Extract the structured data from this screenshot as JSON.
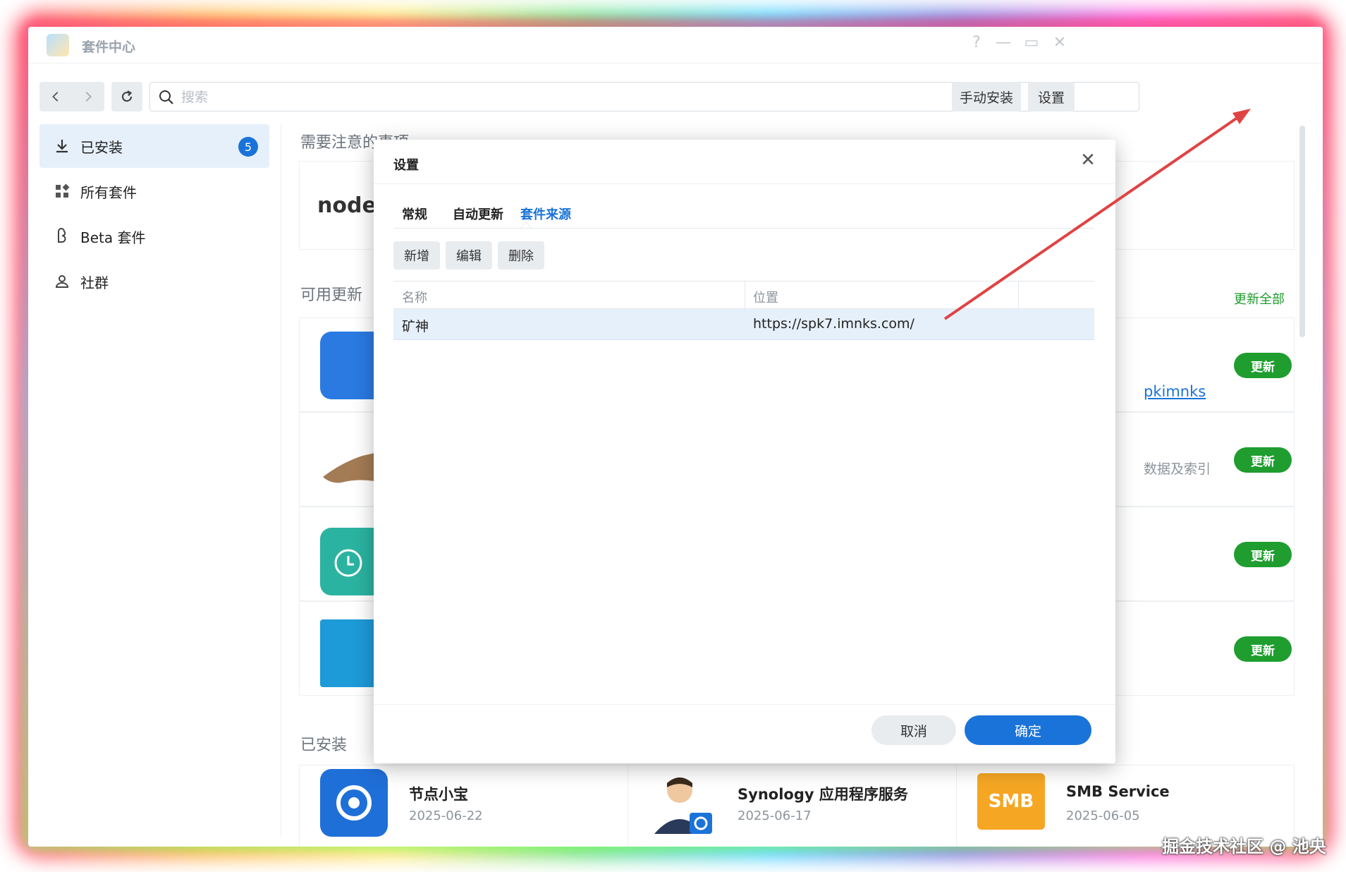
{
  "window": {
    "title": "套件中心",
    "controls": {
      "help": "?",
      "minimize": "—",
      "maximize": "▭",
      "close": "✕"
    }
  },
  "toolbar": {
    "search_placeholder": "搜索",
    "manual_install": "手动安装",
    "settings": "设置"
  },
  "sidebar": {
    "items": [
      {
        "label": "已安装",
        "icon": "download-icon",
        "badge": "5",
        "active": true
      },
      {
        "label": "所有套件",
        "icon": "grid-icon"
      },
      {
        "label": "Beta 套件",
        "icon": "beta-icon"
      },
      {
        "label": "社群",
        "icon": "community-icon"
      }
    ]
  },
  "main": {
    "attention_title": "需要注意的事项",
    "attention_logo": "node",
    "updates_title": "可用更新",
    "update_all": "更新全部",
    "update_label": "更新",
    "peek_link": "pkimnks",
    "peek_text": "数据及索引",
    "installed_title": "已安装",
    "installed": [
      {
        "name": "节点小宝",
        "date": "2025-06-22",
        "icon": "node-helper-icon"
      },
      {
        "name": "Synology 应用程序服务",
        "date": "2025-06-17",
        "icon": "app-service-icon"
      },
      {
        "name": "SMB Service",
        "date": "2025-06-05",
        "icon": "smb-icon",
        "icon_text": "SMB"
      }
    ]
  },
  "dialog": {
    "title": "设置",
    "tabs": [
      {
        "label": "常规"
      },
      {
        "label": "自动更新"
      },
      {
        "label": "套件来源",
        "active": true
      }
    ],
    "buttons": {
      "add": "新增",
      "edit": "编辑",
      "delete": "删除"
    },
    "columns": {
      "name": "名称",
      "location": "位置"
    },
    "rows": [
      {
        "name": "矿神",
        "location": "https://spk7.imnks.com/"
      }
    ],
    "cancel": "取消",
    "ok": "确定"
  },
  "annotation": {
    "arrow_color": "#e04343"
  },
  "watermark": "掘金技术社区 @ 池央",
  "colors": {
    "accent": "#1a73d9",
    "update_green": "#1f9d2f"
  }
}
